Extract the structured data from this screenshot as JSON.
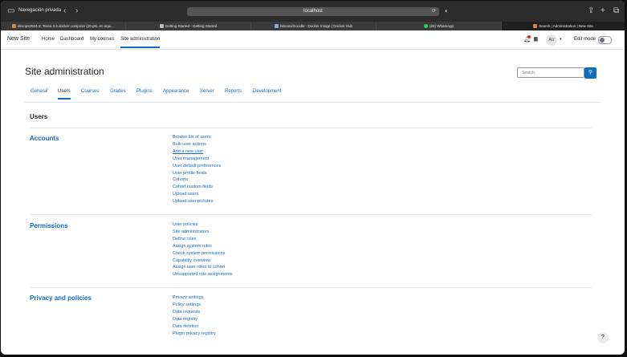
{
  "browser": {
    "private_label": "Navegación privada",
    "url": "localhost",
    "back_icon": "chevron-left-icon",
    "forward_icon": "chevron-right-icon"
  },
  "tabs": [
    {
      "label": "devops2024-3: Tarea 3.3 docker compose (20 pts. en equi...",
      "active": false
    },
    {
      "label": "Getting Started - Getting Started",
      "active": false
    },
    {
      "label": "bitnami/moodle - Docker Image | Docker Hub",
      "active": false
    },
    {
      "label": "(26) WhatsApp",
      "active": false
    },
    {
      "label": "Search | Administration | New Site",
      "active": true
    }
  ],
  "navbar": {
    "brand": "New Site",
    "links": [
      "Home",
      "Dashboard",
      "My courses",
      "Site administration"
    ],
    "avatar": "AU",
    "edit_mode": "Edit mode"
  },
  "page": {
    "title": "Site administration",
    "search_placeholder": "Search",
    "tabs": [
      "General",
      "Users",
      "Courses",
      "Grades",
      "Plugins",
      "Appearance",
      "Server",
      "Reports",
      "Development"
    ],
    "section_heading": "Users"
  },
  "groups": [
    {
      "title": "Accounts",
      "links": [
        "Browse list of users",
        "Bulk user actions",
        "Add a new user",
        "User management",
        "User default preferences",
        "User profile fields",
        "Cohorts",
        "Cohort custom fields",
        "Upload users",
        "Upload user pictures"
      ]
    },
    {
      "title": "Permissions",
      "links": [
        "User policies",
        "Site administrators",
        "Define roles",
        "Assign system roles",
        "Check system permissions",
        "Capability overview",
        "Assign user roles to cohort",
        "Unsupported role assignments"
      ]
    },
    {
      "title": "Privacy and policies",
      "links": [
        "Privacy settings",
        "Policy settings",
        "Data requests",
        "Data registry",
        "Data deletion",
        "Plugin privacy registry"
      ]
    }
  ],
  "help": "?",
  "colors": {
    "accent": "#0f6cbf",
    "text": "#1d2125"
  }
}
